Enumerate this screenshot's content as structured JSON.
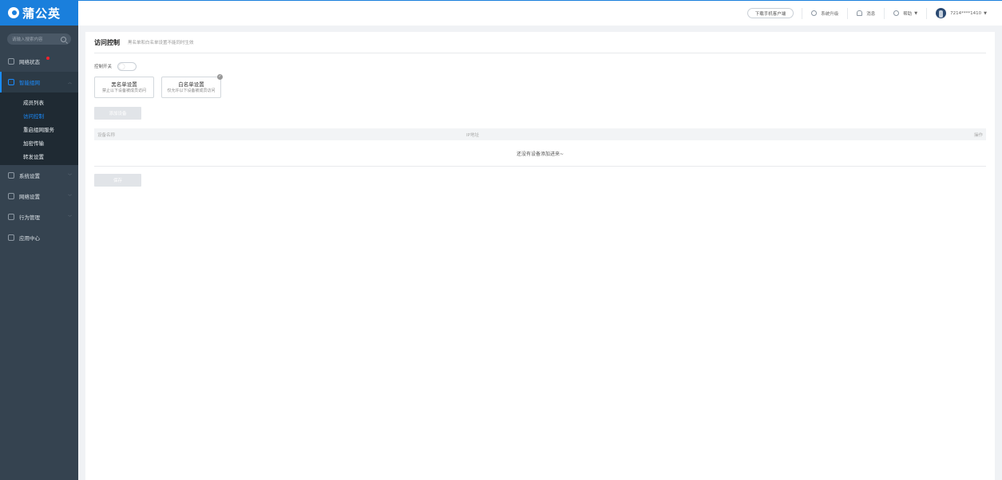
{
  "app": {
    "name": "蒲公英"
  },
  "sidebar": {
    "search_placeholder": "请输入搜索内容",
    "items": [
      {
        "label": "网络状态",
        "icon": "network-status-icon"
      },
      {
        "label": "智能组网",
        "icon": "smart-network-icon",
        "active": true
      },
      {
        "label": "系统设置",
        "icon": "gear-icon"
      },
      {
        "label": "网络设置",
        "icon": "network-settings-icon"
      },
      {
        "label": "行为管理",
        "icon": "behavior-icon"
      },
      {
        "label": "应用中心",
        "icon": "app-center-icon"
      }
    ],
    "submenu": [
      {
        "label": "成员列表"
      },
      {
        "label": "访问控制",
        "active": true
      },
      {
        "label": "重启组网服务"
      },
      {
        "label": "加密传输"
      },
      {
        "label": "转发设置"
      }
    ]
  },
  "header": {
    "download_label": "下载手机客户端",
    "upgrade_label": "系统升级",
    "messages_label": "消息",
    "help_label": "帮助",
    "user_label": "7214****1410"
  },
  "main": {
    "title": "访问控制",
    "subtitle": "黑名单和白名单设置不能同时生效",
    "switch_label": "控制开关",
    "switch_on": false,
    "cards": [
      {
        "title": "黑名单设置",
        "desc": "禁止以下设备被成员访问",
        "selected": false
      },
      {
        "title": "白名单设置",
        "desc": "仅允许以下设备被成员访问",
        "selected": true
      }
    ],
    "add_button": "添加设备",
    "table": {
      "columns": [
        "设备名称",
        "IP地址",
        "操作"
      ],
      "empty_text": "还没有设备添加进来~"
    },
    "save_button": "保存"
  },
  "colors": {
    "brand": "#1a7fdc",
    "accent": "#1a8cff",
    "sidebar_bg": "#354350"
  }
}
